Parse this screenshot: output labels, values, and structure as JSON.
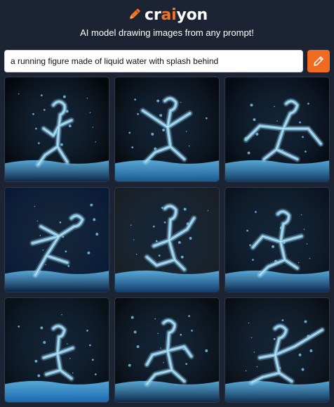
{
  "app": {
    "logo_left": "cr",
    "logo_accent": "ai",
    "logo_right": "yon",
    "tagline": "AI model drawing images from any prompt!"
  },
  "prompt": {
    "value": "a running figure made of liquid water with splash behind",
    "draw_button_icon": "pencil-icon"
  },
  "colors": {
    "background": "#1c2434",
    "accent": "#f06a22",
    "water": "#7ec8ef"
  },
  "results": {
    "tiles": [
      {
        "icon": "generated-image",
        "bg": "#05080d",
        "water": "#0c2a4a"
      },
      {
        "icon": "generated-image",
        "bg": "#070a10",
        "water": "#1a5a90"
      },
      {
        "icon": "generated-image",
        "bg": "#060a12",
        "water": "#0f3c66"
      },
      {
        "icon": "generated-image",
        "bg": "#0a1a36",
        "water": "#0b2244"
      },
      {
        "icon": "generated-image",
        "bg": "#1a1f24",
        "water": "#113e70"
      },
      {
        "icon": "generated-image",
        "bg": "#0a1420",
        "water": "#0c2c52"
      },
      {
        "icon": "generated-image",
        "bg": "#081018",
        "water": "#1868b0"
      },
      {
        "icon": "generated-image",
        "bg": "#090d12",
        "water": "#0c2a48"
      },
      {
        "icon": "generated-image",
        "bg": "#0b0f15",
        "water": "#0e3256"
      }
    ]
  }
}
